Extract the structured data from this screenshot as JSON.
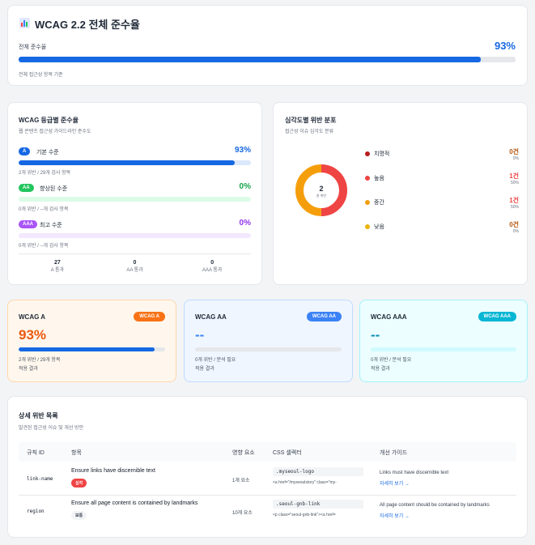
{
  "overall": {
    "title": "WCAG 2.2 전체 준수율",
    "label": "전체 준수율",
    "value": "93%",
    "fraction": 0.93,
    "caption": "전체 접근성 항목 기준"
  },
  "levels": {
    "title": "WCAG 등급별 준수율",
    "subtitle": "웹 콘텐츠 접근성 가이드라인 준수도",
    "items": [
      {
        "badge": "A",
        "label": "기본 수준",
        "value": "93%",
        "fraction": 0.93,
        "meta": "2개 위반 / 29개 검사 항목",
        "color": "#1668e3",
        "track": "#dbe7fb",
        "pct_color": "#1668e3"
      },
      {
        "badge": "AA",
        "label": "향상된 수준",
        "value": "0%",
        "fraction": 0,
        "meta": "0개 위반 / --개 검사 항목",
        "color": "#22c55e",
        "track": "#dcfce7",
        "pct_color": "#16a34a"
      },
      {
        "badge": "AAA",
        "label": "최고 수준",
        "value": "0%",
        "fraction": 0,
        "meta": "0개 위반 / --개 검사 항목",
        "color": "#a855f7",
        "track": "#f3e8ff",
        "pct_color": "#9333ea"
      }
    ],
    "stats": [
      {
        "value": "27",
        "label": "A 통과"
      },
      {
        "value": "0",
        "label": "AA 통과"
      },
      {
        "value": "0",
        "label": "AAA 통과"
      }
    ]
  },
  "severity": {
    "title": "심각도별 위반 분포",
    "subtitle": "접근성 이슈 심각도 분류",
    "donut_value": "2",
    "donut_label": "총 위반",
    "items": [
      {
        "name": "치명적",
        "count": "0건",
        "pct": "0%",
        "share": 0,
        "color": "#b91c1c"
      },
      {
        "name": "높음",
        "count": "1건",
        "pct": "50%",
        "share": 0.5,
        "color": "#ef4444"
      },
      {
        "name": "중간",
        "count": "1건",
        "pct": "50%",
        "share": 0.5,
        "color": "#f59e0b"
      },
      {
        "name": "낮음",
        "count": "0건",
        "pct": "0%",
        "share": 0,
        "color": "#eab308"
      }
    ]
  },
  "wcag_cards": [
    {
      "title": "WCAG A",
      "tag": "WCAG A",
      "value": "93%",
      "fraction": 0.93,
      "sub1": "2개 위반 / 29개 항목",
      "sub2": "적용 결과",
      "bg": "#fff7ed",
      "border": "#fed7aa",
      "tag_color": "#f97316",
      "value_color": "#ea580c",
      "track": "#e5e7eb",
      "fill": "#1668e3"
    },
    {
      "title": "WCAG AA",
      "tag": "WCAG AA",
      "value": "--",
      "fraction": 0,
      "sub1": "0개 위반 / 분석 필요",
      "sub2": "적용 결과",
      "bg": "#eff6ff",
      "border": "#bfdbfe",
      "tag_color": "#3b82f6",
      "value_color": "#3b82f6",
      "track": "#e5e7eb",
      "fill": "#3b82f6"
    },
    {
      "title": "WCAG AAA",
      "tag": "WCAG AAA",
      "value": "--",
      "fraction": 0,
      "sub1": "0개 위반 / 분석 필요",
      "sub2": "적용 결과",
      "bg": "#ecfeff",
      "border": "#a5f3fc",
      "tag_color": "#06b6d4",
      "value_color": "#0891b2",
      "track": "#cffafe",
      "fill": "#06b6d4"
    }
  ],
  "details": {
    "title": "상세 위반 목록",
    "subtitle": "발견된 접근성 이슈 및 개선 방안",
    "columns": [
      "규칙 ID",
      "항목",
      "영향 요소",
      "CSS 셀렉터",
      "개선 가이드"
    ],
    "rows": [
      {
        "rule": "link-name",
        "item": "Ensure links have discernible text",
        "badge": "심각",
        "badge_color": "#ef4444",
        "badge_text_color": "#ffffff",
        "impact": "1개 요소",
        "selector": ".myseoul-logo",
        "snippet": "<a href=\"/myseoulstory\" class=\"my-",
        "guide": "Links must have discernible text",
        "link": "자세히 보기 →"
      },
      {
        "rule": "region",
        "item": "Ensure all page content is contained by landmarks",
        "badge": "보통",
        "badge_color": "#f3f4f6",
        "badge_text_color": "#374151",
        "impact": "10개 요소",
        "selector": ".seoul-gnb-link",
        "snippet": "<p class=\"seoul-gnb-link\"><a href=",
        "guide": "All page content should be contained by landmarks",
        "link": "자세히 보기 →"
      }
    ]
  }
}
